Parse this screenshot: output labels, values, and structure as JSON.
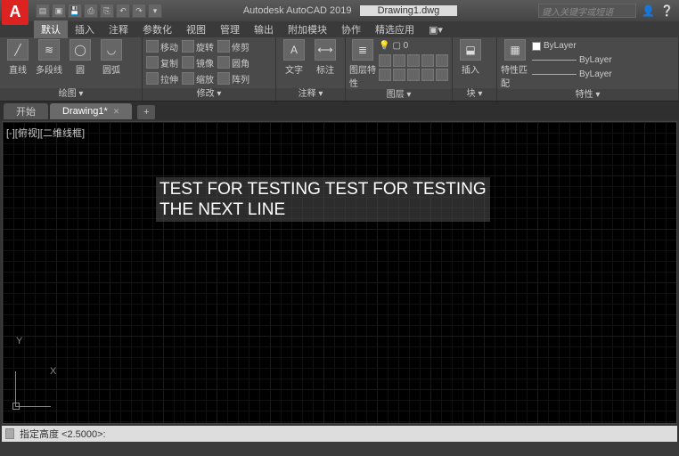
{
  "title": {
    "app": "Autodesk AutoCAD 2019",
    "doc": "Drawing1.dwg",
    "search_placeholder": "键入关键字或短语"
  },
  "menus": [
    "默认",
    "插入",
    "注释",
    "参数化",
    "视图",
    "管理",
    "输出",
    "附加模块",
    "协作",
    "精选应用"
  ],
  "menu_active_index": 0,
  "ribbon": {
    "draw": {
      "title": "绘图 ▾",
      "line": "直线",
      "polyline": "多段线",
      "circle": "圆",
      "arc": "圆弧"
    },
    "modify": {
      "title": "修改 ▾",
      "items": [
        "移动",
        "旋转",
        "修剪",
        "复制",
        "镜像",
        "圆角",
        "拉伸",
        "缩放",
        "阵列"
      ]
    },
    "anno": {
      "title": "注释 ▾",
      "text": "文字",
      "dim": "标注"
    },
    "layer": {
      "title": "图层 ▾",
      "btn": "图层特性"
    },
    "block": {
      "title": "块 ▾",
      "btn": "插入"
    },
    "prop": {
      "title": "特性 ▾",
      "btn": "特性匹配",
      "bylayer": "ByLayer"
    }
  },
  "tabs": {
    "start": "开始",
    "file": "Drawing1*",
    "add": "+"
  },
  "viewport": {
    "label": "[-][俯视][二维线框]"
  },
  "drawing_text": "TEST FOR TESTING TEST FOR TESTING\nTHE NEXT LINE",
  "ucs": {
    "x": "X",
    "y": "Y"
  },
  "command": {
    "prompt": "指定高度 <2.5000>:"
  }
}
